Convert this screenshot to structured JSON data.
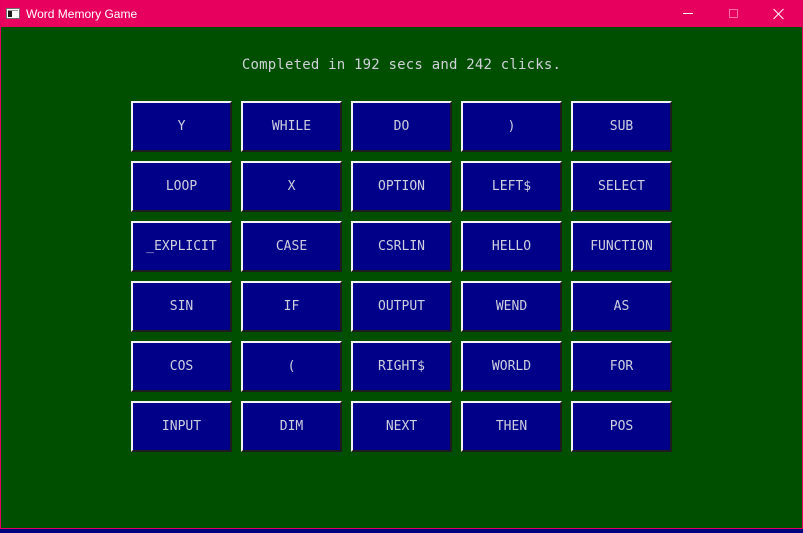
{
  "window": {
    "title": "Word Memory Game",
    "controls": {
      "minimize": "minimize-icon",
      "maximize": "maximize-icon",
      "close": "close-icon"
    }
  },
  "status": "Completed in 192 secs and 242 clicks.",
  "colors": {
    "background": "#004f00",
    "titlebar": "#e8005f",
    "tile": "#000088",
    "tile_text": "#cfcfe0",
    "status_text": "#cfd2d8"
  },
  "tiles": [
    [
      "Y",
      "WHILE",
      "DO",
      ")",
      "SUB"
    ],
    [
      "LOOP",
      "X",
      "OPTION",
      "LEFT$",
      "SELECT"
    ],
    [
      "_EXPLICIT",
      "CASE",
      "CSRLIN",
      "HELLO",
      "FUNCTION"
    ],
    [
      "SIN",
      "IF",
      "OUTPUT",
      "WEND",
      "AS"
    ],
    [
      "COS",
      "(",
      "RIGHT$",
      "WORLD",
      "FOR"
    ],
    [
      "INPUT",
      "DIM",
      "NEXT",
      "THEN",
      "POS"
    ]
  ]
}
